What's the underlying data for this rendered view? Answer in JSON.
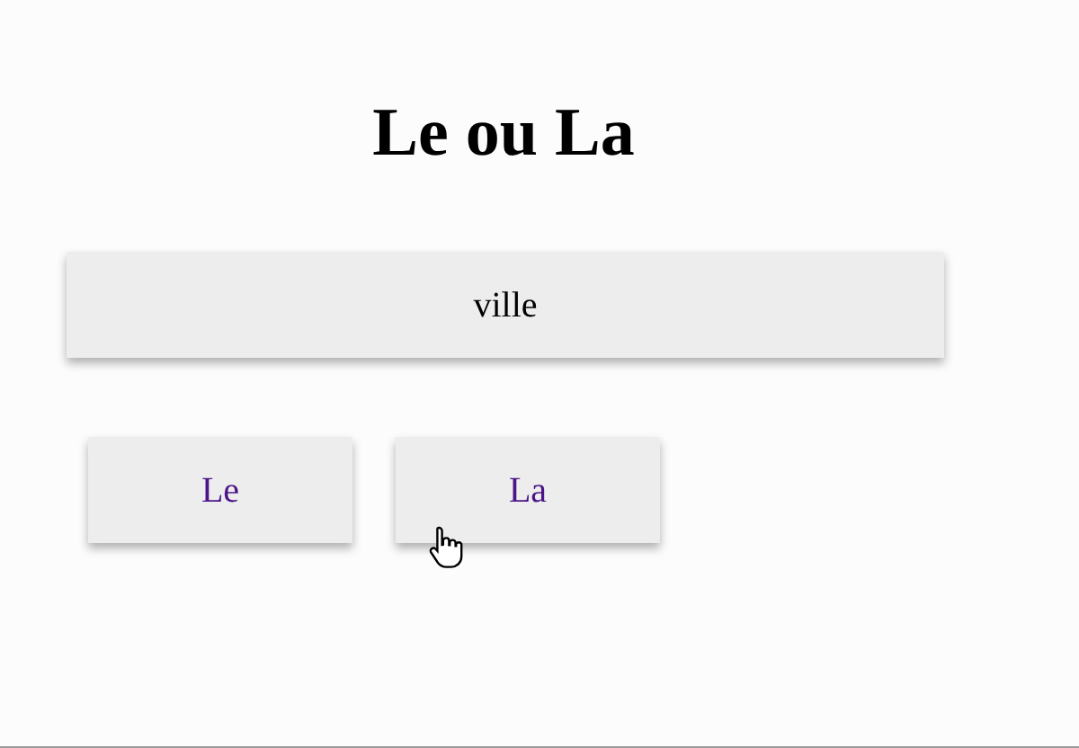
{
  "title": "Le ou La",
  "word": "ville",
  "choices": [
    {
      "label": "Le"
    },
    {
      "label": "La"
    }
  ]
}
